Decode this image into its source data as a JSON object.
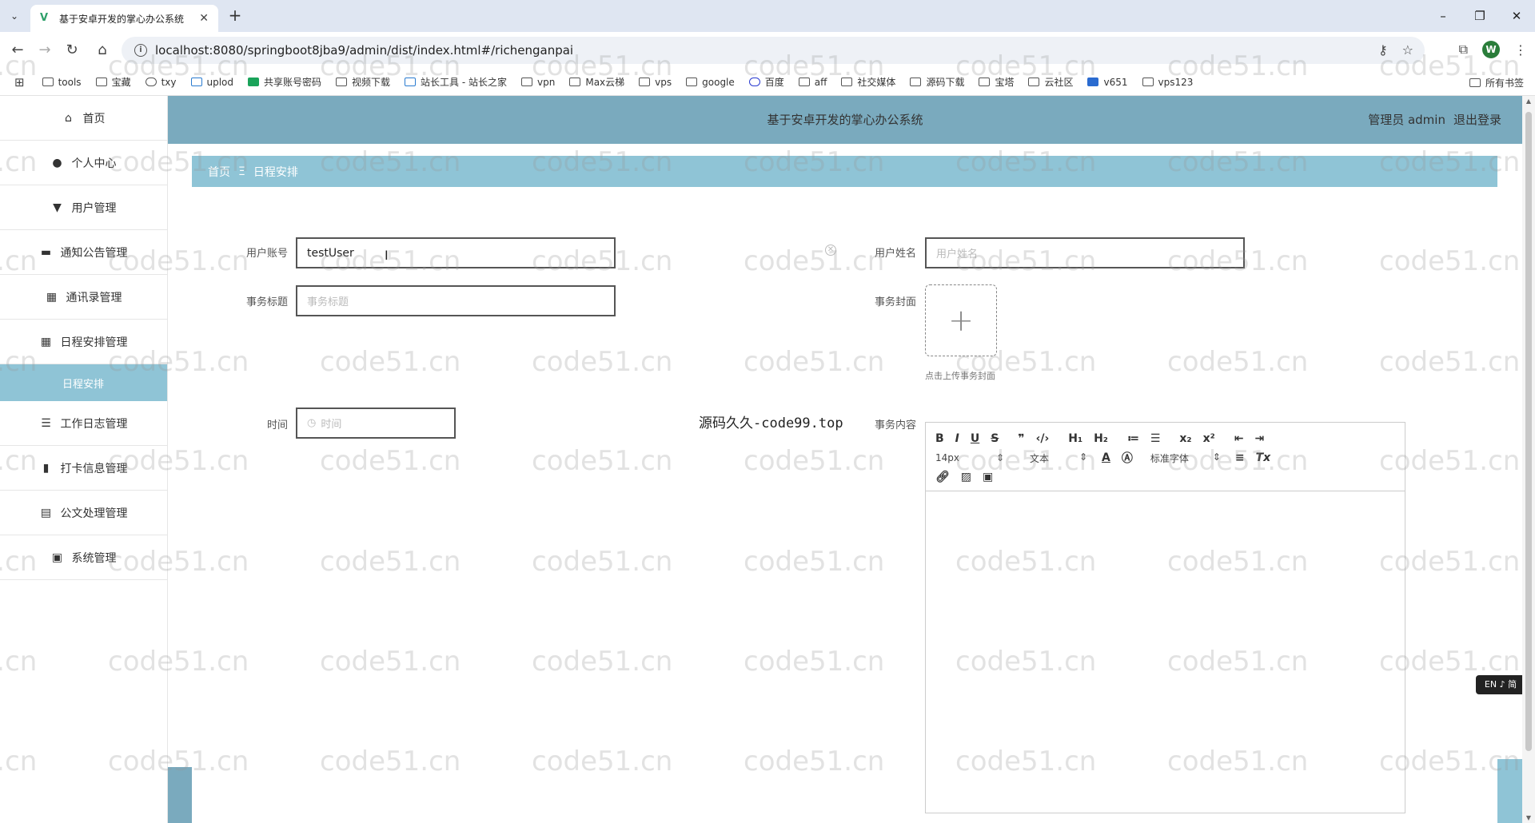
{
  "browser": {
    "tab_title": "基于安卓开发的掌心办公系统",
    "url": "localhost:8080/springboot8jba9/admin/dist/index.html#/richenganpai",
    "profile_initial": "W",
    "bookmarks": [
      "tools",
      "宝藏",
      "txy",
      "uplod",
      "共享账号密码",
      "视频下载",
      "站长工具 - 站长之家",
      "vpn",
      "Max云梯",
      "vps",
      "google",
      "百度",
      "aff",
      "社交媒体",
      "源码下载",
      "宝塔",
      "云社区",
      "v651",
      "vps123"
    ],
    "all_bookmarks": "所有书签"
  },
  "sidebar": {
    "items": [
      {
        "label": "首页",
        "icon": "home-icon"
      },
      {
        "label": "个人中心",
        "icon": "person-icon"
      },
      {
        "label": "用户管理",
        "icon": "user-manage-icon"
      },
      {
        "label": "通知公告管理",
        "icon": "notice-icon"
      },
      {
        "label": "通讯录管理",
        "icon": "grid-icon"
      },
      {
        "label": "日程安排管理",
        "icon": "grid-icon"
      },
      {
        "label": "日程安排",
        "icon": ""
      },
      {
        "label": "工作日志管理",
        "icon": "sliders-icon"
      },
      {
        "label": "打卡信息管理",
        "icon": "chart-icon"
      },
      {
        "label": "公文处理管理",
        "icon": "clipboard-icon"
      },
      {
        "label": "系统管理",
        "icon": "system-icon"
      }
    ]
  },
  "header": {
    "title": "基于安卓开发的掌心办公系统",
    "user": "管理员 admin",
    "logout": "退出登录"
  },
  "breadcrumb": {
    "home": "首页",
    "separator": "Ξ",
    "current": "日程安排"
  },
  "form": {
    "account_label": "用户账号",
    "account_value": "testUser",
    "name_label": "用户姓名",
    "name_placeholder": "用户姓名",
    "title_label": "事务标题",
    "title_placeholder": "事务标题",
    "cover_label": "事务封面",
    "cover_hint": "点击上传事务封面",
    "time_label": "时间",
    "time_placeholder": "时间",
    "content_label": "事务内容"
  },
  "overlay_text": "源码久久-code99.top",
  "editor": {
    "font_size": "14px",
    "block_type": "文本",
    "font_family": "标准字体"
  },
  "ime_indicator": "EN ♪ 简",
  "watermark": "code51.cn",
  "colors": {
    "header_bg": "#7aaabe",
    "breadcrumb_bg": "#8fc4d6",
    "active_sub_bg": "#8fc4d6"
  }
}
